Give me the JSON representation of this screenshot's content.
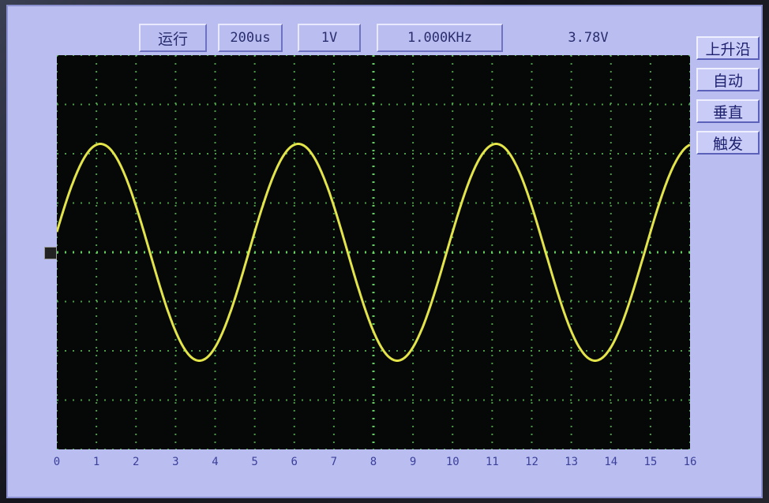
{
  "toolbar": {
    "run_label": "运行",
    "timebase": "200us",
    "volts_div": "1V",
    "frequency": "1.000KHz",
    "amplitude": "3.78V"
  },
  "side_buttons": [
    "上升沿",
    "自动",
    "垂直",
    "触发"
  ],
  "colors": {
    "trace": "#e3e34a",
    "grid": "#69d964",
    "plot_bg": "#050806",
    "screen_bg": "#b9bdf0",
    "label": "#3b3f9a"
  },
  "chart_data": {
    "type": "line",
    "x_ticks": [
      "0",
      "1",
      "2",
      "3",
      "4",
      "5",
      "6",
      "7",
      "8",
      "9",
      "10",
      "11",
      "12",
      "13",
      "14",
      "15",
      "16"
    ],
    "xlim": [
      0,
      16
    ],
    "ylim": [
      -4,
      4
    ],
    "grid": true,
    "series": [
      {
        "color": "#e3e34a",
        "waveform": "sine",
        "frequency_khz": 1.0,
        "amplitude_divs": 2.2,
        "period_divs": 5.0,
        "phase_peak_at": 1.1
      }
    ]
  }
}
